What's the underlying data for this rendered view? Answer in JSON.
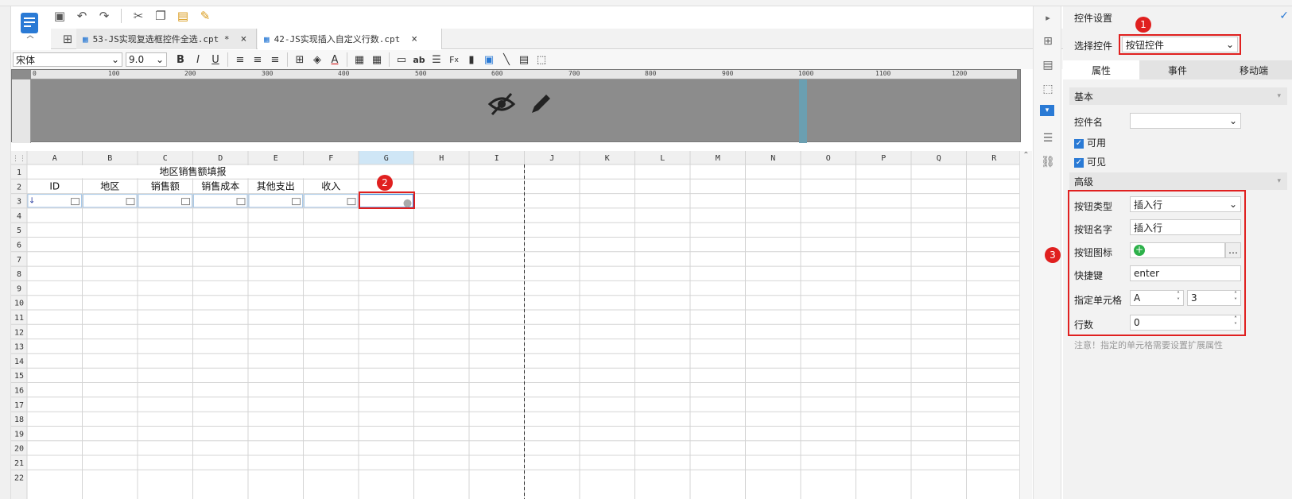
{
  "toolbar": {
    "font_name": "宋体",
    "font_size": "9.0"
  },
  "tabs": [
    {
      "label": "53-JS实现复选框控件全选.cpt *",
      "close": "×"
    },
    {
      "label": "42-JS实现插入自定义行数.cpt",
      "close": "×"
    }
  ],
  "ruler_ticks": [
    "0",
    "100",
    "200",
    "300",
    "400",
    "500",
    "600",
    "700",
    "800",
    "900",
    "1000",
    "1100",
    "1200"
  ],
  "grid": {
    "columns": [
      "A",
      "B",
      "C",
      "D",
      "E",
      "F",
      "G",
      "H",
      "I",
      "J",
      "K",
      "L",
      "M",
      "N",
      "O",
      "P",
      "Q",
      "R"
    ],
    "rows": [
      "1",
      "2",
      "3",
      "4",
      "5",
      "6",
      "7",
      "8",
      "9",
      "10",
      "11",
      "12",
      "13",
      "14",
      "15",
      "16",
      "17",
      "18",
      "19",
      "20",
      "21",
      "22"
    ],
    "title": "地区销售额填报",
    "headers": [
      "ID",
      "地区",
      "销售额",
      "销售成本",
      "其他支出",
      "收入"
    ]
  },
  "panel": {
    "title": "控件设置",
    "select_label": "选择控件",
    "select_value": "按钮控件",
    "tabs": [
      "属性",
      "事件",
      "移动端"
    ],
    "basic": "基本",
    "name_label": "控件名",
    "enabled": "可用",
    "visible": "可见",
    "advanced": "高级",
    "btn_type_label": "按钮类型",
    "btn_type_value": "插入行",
    "btn_name_label": "按钮名字",
    "btn_name_value": "插入行",
    "btn_icon_label": "按钮图标",
    "shortcut_label": "快捷键",
    "shortcut_value": "enter",
    "cell_label": "指定单元格",
    "cell_col": "A",
    "cell_row": "3",
    "rows_label": "行数",
    "rows_value": "0",
    "note": "注意！指定的单元格需要设置扩展属性"
  },
  "badges": [
    "1",
    "2",
    "3"
  ],
  "colors": {
    "accent": "#2a7ad5",
    "highlight": "#e0201f",
    "selected_col": "#cfe6f6"
  }
}
